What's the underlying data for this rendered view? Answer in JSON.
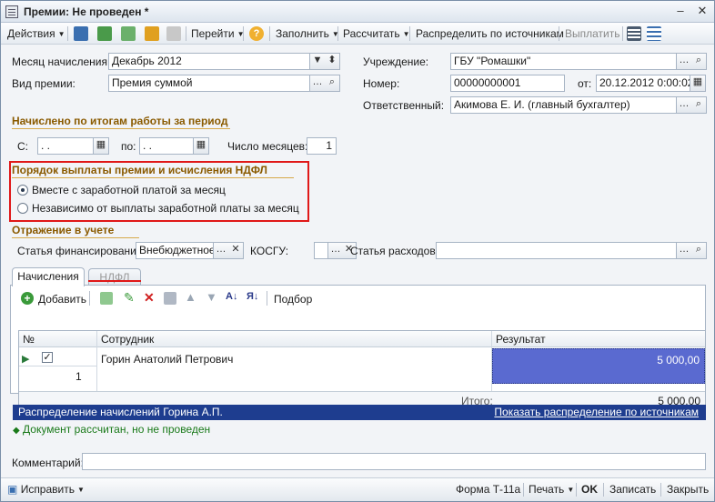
{
  "window": {
    "title": "Премии: Не проведен *"
  },
  "toolbar": {
    "actions": "Действия",
    "goto": "Перейти",
    "fill": "Заполнить",
    "calculate": "Рассчитать",
    "distribute": "Распределить по источникам",
    "pay": "Выплатить"
  },
  "header": {
    "month_label": "Месяц начисления:",
    "month_value": "Декабрь 2012",
    "bonus_type_label": "Вид премии:",
    "bonus_type_value": "Премия суммой",
    "institution_label": "Учреждение:",
    "institution_value": "ГБУ \"Ромашки\"",
    "number_label": "Номер:",
    "number_value": "00000000001",
    "date_label": "от:",
    "date_value": "20.12.2012  0:00:02",
    "responsible_label": "Ответственный:",
    "responsible_value": "Акимова Е. И. (главный бухгалтер)"
  },
  "period": {
    "section_title": "Начислено по итогам работы за период",
    "from_label": "С:",
    "from_value": " .  .",
    "to_label": "по:",
    "to_value": " .  .",
    "months_label": "Число месяцев:",
    "months_value": "1"
  },
  "payment_order": {
    "section_title": "Порядок выплаты премии и исчисления НДФЛ",
    "option1": "Вместе с заработной платой за месяц",
    "option2": "Независимо от выплаты заработной платы за месяц",
    "selected": 1
  },
  "accounting": {
    "section_title": "Отражение в учете",
    "financing_label": "Статья финансирования:",
    "financing_value": "Внебюджетное",
    "kosgu_label": "КОСГУ:",
    "kosgu_value": "",
    "expense_label": "Статья расходов:",
    "expense_value": ""
  },
  "tabs": {
    "accruals": "Начисления",
    "ndfl": "НДФЛ"
  },
  "grid_toolbar": {
    "add": "Добавить",
    "select": "Подбор"
  },
  "grid": {
    "columns": {
      "num": "№",
      "employee": "Сотрудник",
      "result": "Результат"
    },
    "rows": [
      {
        "num": "1",
        "employee": "Горин Анатолий Петрович",
        "result": "5 000,00"
      }
    ],
    "total_label": "Итого:",
    "total_value": "5 000,00"
  },
  "infobar": {
    "text": "Распределение начислений Горина А.П.",
    "link": "Показать распределение по источникам"
  },
  "status": {
    "text": "Документ рассчитан, но не проведен"
  },
  "comment": {
    "label": "Комментарий:",
    "value": ""
  },
  "bottom": {
    "fix": "Исправить",
    "form": "Форма Т-11а",
    "print": "Печать",
    "ok": "OK",
    "save": "Записать",
    "close": "Закрыть"
  }
}
